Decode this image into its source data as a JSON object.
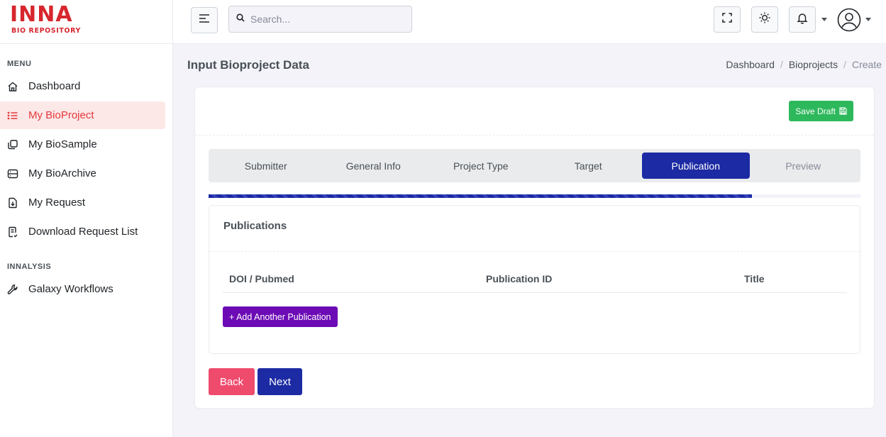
{
  "brand": {
    "logo_text": "INNA",
    "logo_subtitle": "BIO REPOSITORY",
    "color": "#d7262e"
  },
  "sidebar": {
    "sections": [
      {
        "title": "MENU"
      },
      {
        "title": "INNALYSIS"
      }
    ],
    "items": [
      {
        "label": "Dashboard",
        "icon": "home-icon"
      },
      {
        "label": "My BioProject",
        "icon": "list-icon",
        "active": true
      },
      {
        "label": "My BioSample",
        "icon": "copy-icon"
      },
      {
        "label": "My BioArchive",
        "icon": "archive-icon"
      },
      {
        "label": "My Request",
        "icon": "file-download-icon"
      },
      {
        "label": "Download Request List",
        "icon": "file-list-icon"
      },
      {
        "label": "Galaxy Workflows",
        "icon": "wrench-icon"
      }
    ]
  },
  "topbar": {
    "search_placeholder": "Search...",
    "icons": [
      "menu-icon",
      "search-icon",
      "fullscreen-icon",
      "sun-icon",
      "bell-icon",
      "user-avatar-icon"
    ]
  },
  "page": {
    "title": "Input Bioproject Data",
    "breadcrumb": [
      "Dashboard",
      "Bioprojects",
      "Create"
    ]
  },
  "card": {
    "save_draft_label": "Save Draft",
    "steps": [
      {
        "label": "Submitter"
      },
      {
        "label": "General Info"
      },
      {
        "label": "Project Type"
      },
      {
        "label": "Target"
      },
      {
        "label": "Publication",
        "active": true
      },
      {
        "label": "Preview",
        "disabled": true
      }
    ],
    "progress_fraction": 0.833
  },
  "publications": {
    "header": "Publications",
    "columns": [
      "DOI / Pubmed",
      "Publication ID",
      "Title"
    ],
    "add_button_label": "+ Add Another Publication"
  },
  "actions": {
    "back_label": "Back",
    "next_label": "Next"
  },
  "colors": {
    "primary": "#1c2aa3",
    "active_nav_bg": "#fde8e8",
    "active_nav_text": "#e5383b",
    "save_green": "#2eb85c",
    "add_purple": "#6c0bb5",
    "back_pink": "#ef4b6d"
  }
}
